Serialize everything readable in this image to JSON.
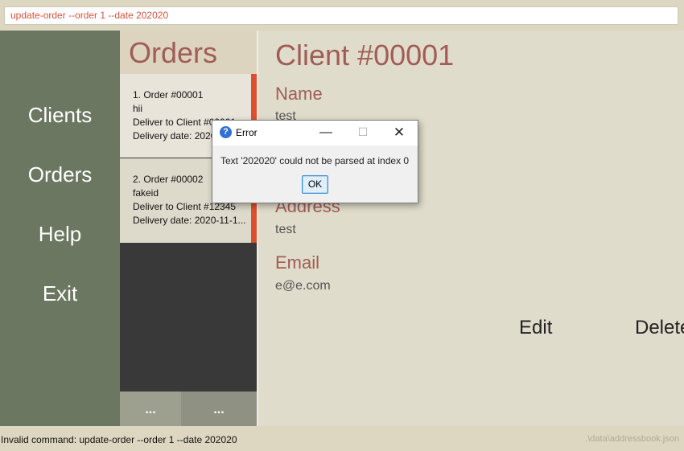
{
  "command_box": {
    "value": "update-order --order 1 --date 202020"
  },
  "nav": {
    "items": [
      {
        "label": "Clients"
      },
      {
        "label": "Orders"
      },
      {
        "label": "Help"
      },
      {
        "label": "Exit"
      }
    ]
  },
  "orders_panel": {
    "title": "Orders",
    "cards": [
      {
        "header": "1.   Order #00001",
        "description": "hii",
        "deliver_to": "Deliver to Client #00001",
        "delivery_date": "Delivery date: 2020-11-1..."
      },
      {
        "header": "2.   Order #00002",
        "description": "fakeid",
        "deliver_to": "Deliver to Client #12345",
        "delivery_date": "Delivery date: 2020-11-1..."
      }
    ],
    "tabs": [
      {
        "label": "..."
      },
      {
        "label": "..."
      }
    ]
  },
  "client_detail": {
    "title": "Client #00001",
    "fields": [
      {
        "label": "Name",
        "value": "test"
      },
      {
        "label": "Address",
        "value": "test"
      },
      {
        "label": "Email",
        "value": "e@e.com"
      }
    ],
    "actions": {
      "edit": "Edit",
      "delete": "Delete"
    }
  },
  "error_dialog": {
    "title": "Error",
    "icon": "question-icon",
    "message": "Text '202020' could not be parsed at index 0",
    "ok_label": "OK",
    "window_buttons": {
      "minimize": "—",
      "maximize": "☐",
      "close": "✕"
    }
  },
  "status_bar": {
    "message": "Invalid command: update-order --order 1 --date 202020",
    "file_path": ".\\data\\addressbook.json"
  },
  "colors": {
    "accent": "#a15c56",
    "nav_bg": "#6b7761",
    "card_marker": "#e04e2e",
    "command_text": "#d2533b"
  }
}
